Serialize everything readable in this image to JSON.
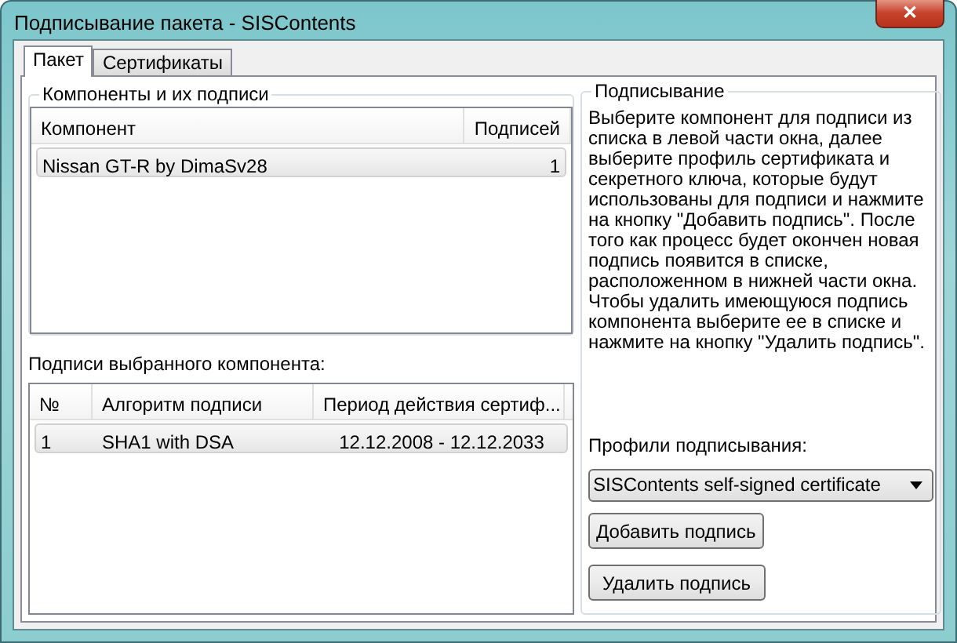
{
  "window": {
    "title": "Подписывание пакета - SISContents",
    "close_button": "✕"
  },
  "tabs": [
    {
      "label": "Пакет",
      "selected": true
    },
    {
      "label": "Сертификаты",
      "selected": false
    }
  ],
  "components": {
    "title": "Компоненты и их подписи",
    "columns": [
      "Компонент",
      "Подписей"
    ],
    "rows": [
      {
        "cells": [
          "Nissan GT-R by DimaSv28",
          "1"
        ],
        "selected": true
      }
    ]
  },
  "signatures": {
    "title": "Подписи выбранного компонента:",
    "columns": [
      "№",
      "Алгоритм подписи",
      "Период действия сертиф..."
    ],
    "rows": [
      {
        "cells": [
          "1",
          "SHA1 with DSA",
          "12.12.2008 - 12.12.2033"
        ],
        "selected": true
      }
    ]
  },
  "signing": {
    "title": "Подписывание",
    "instructions": "Выберите компонент для подписи из списка в левой части окна, далее выберите профиль сертификата и секретного ключа, которые будут использованы для подписи и нажмите на кнопку \"Добавить подпись\". После того как процесс будет окончен новая подпись появится в списке, расположенном в нижней части окна.\nЧтобы удалить имеющуюся подпись компонента выберите ее в списке и нажмите на кнопку \"Удалить подпись\".",
    "profiles_label": "Профили подписывания:",
    "profile": "SISContents self-signed certificate",
    "buttons": [
      "Добавить подпись",
      "Удалить подпись"
    ]
  }
}
